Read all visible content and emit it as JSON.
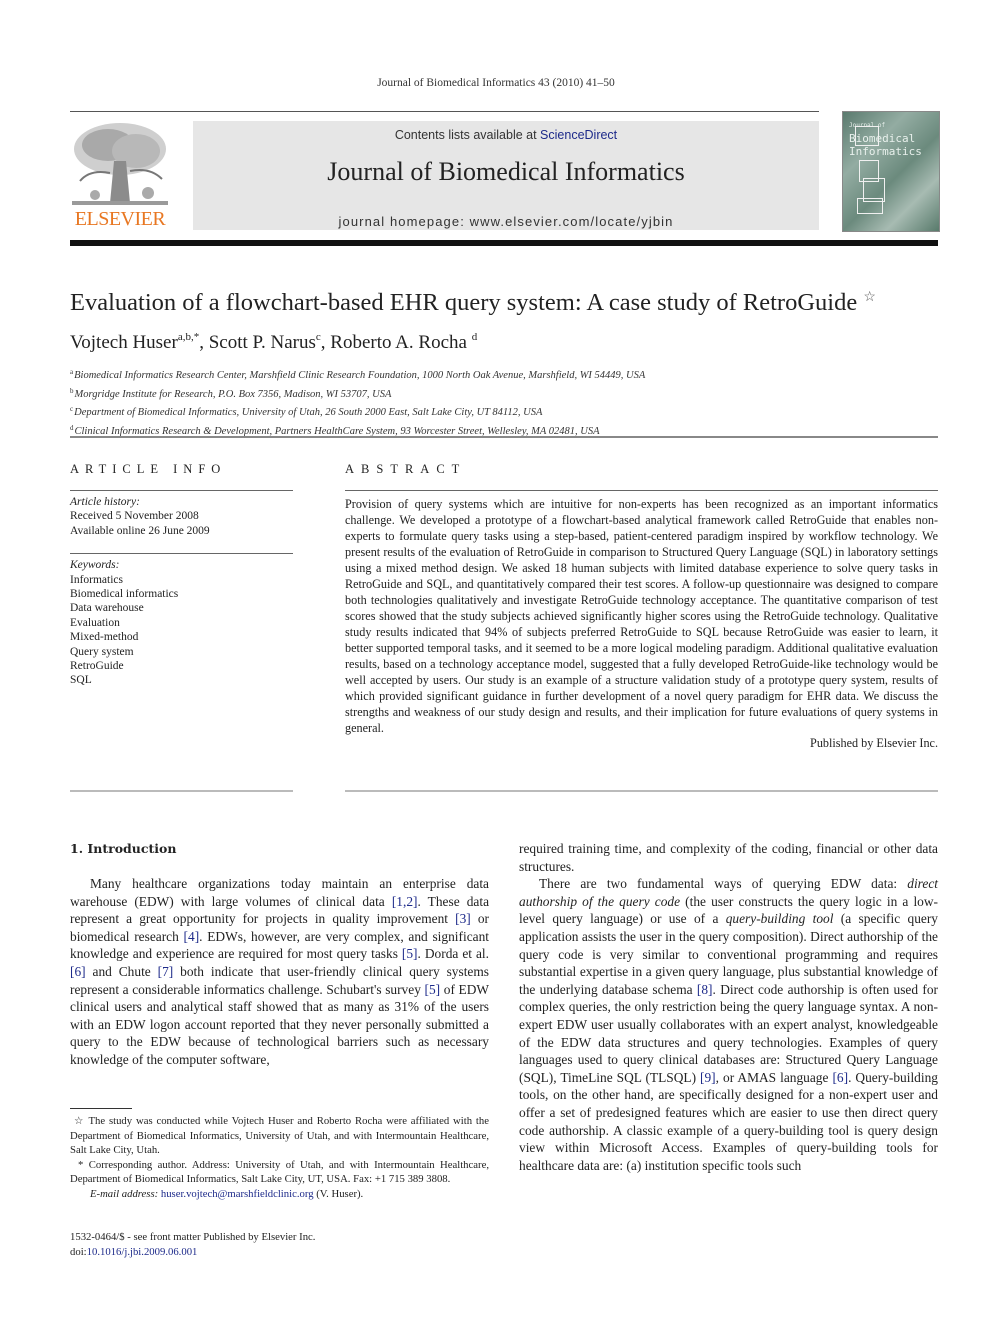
{
  "running_head": "Journal of Biomedical Informatics 43 (2010) 41–50",
  "banner": {
    "contents_prefix": "Contents lists available at ",
    "contents_link": "ScienceDirect",
    "journal_title": "Journal of Biomedical Informatics",
    "homepage": "journal homepage: www.elsevier.com/locate/yjbin"
  },
  "publisher_logo": {
    "wordmark": "ELSEVIER",
    "icon": "elsevier-tree-icon",
    "color": "#e87722"
  },
  "cover": {
    "line1": "Biomedical",
    "line2": "Informatics",
    "small": "Journal of"
  },
  "article": {
    "title": "Evaluation of a flowchart-based EHR query system: A case study of RetroGuide",
    "title_note": "☆",
    "authors": [
      {
        "name": "Vojtech Huser",
        "sup": "a,b,*",
        "sep": ", "
      },
      {
        "name": "Scott P. Narus",
        "sup": "c",
        "sep": ", "
      },
      {
        "name": "Roberto A. Rocha",
        "sup": "d",
        "sep": ""
      }
    ],
    "affiliations": [
      {
        "key": "a",
        "text": "Biomedical Informatics Research Center, Marshfield Clinic Research Foundation, 1000 North Oak Avenue, Marshfield, WI 54449, USA"
      },
      {
        "key": "b",
        "text": "Morgridge Institute for Research, P.O. Box 7356, Madison, WI 53707, USA"
      },
      {
        "key": "c",
        "text": "Department of Biomedical Informatics, University of Utah, 26 South 2000 East, Salt Lake City, UT 84112, USA"
      },
      {
        "key": "d",
        "text": "Clinical Informatics Research & Development, Partners HealthCare System, 93 Worcester Street, Wellesley, MA 02481, USA"
      }
    ]
  },
  "article_info": {
    "heading": "ARTICLE INFO",
    "history_label": "Article history:",
    "received": "Received 5 November 2008",
    "available": "Available online 26 June 2009",
    "keywords_label": "Keywords:",
    "keywords": [
      "Informatics",
      "Biomedical informatics",
      "Data warehouse",
      "Evaluation",
      "Mixed-method",
      "Query system",
      "RetroGuide",
      "SQL"
    ]
  },
  "abstract": {
    "heading": "ABSTRACT",
    "body": "Provision of query systems which are intuitive for non-experts has been recognized as an important informatics challenge. We developed a prototype of a flowchart-based analytical framework called RetroGuide that enables non-experts to formulate query tasks using a step-based, patient-centered par­adigm inspired by workflow technology. We present results of the evaluation of RetroGuide in compar­ison to Structured Query Language (SQL) in laboratory settings using a mixed method design. We asked 18 human subjects with limited database experience to solve query tasks in RetroGuide and SQL, and quantitatively compared their test scores. A follow-up questionnaire was designed to compare both tech­nologies qualitatively and investigate RetroGuide technology acceptance. The quantitative comparison of test scores showed that the study subjects achieved significantly higher scores using the RetroGuide tech­nology. Qualitative study results indicated that 94% of subjects preferred RetroGuide to SQL because Ret­roGuide was easier to learn, it better supported temporal tasks, and it seemed to be a more logical modeling paradigm. Additional qualitative evaluation results, based on a technology acceptance model, suggested that a fully developed RetroGuide-like technology would be well accepted by users. Our study is an example of a structure validation study of a prototype query system, results of which provided sig­nificant guidance in further development of a novel query paradigm for EHR data. We discuss the strengths and weakness of our study design and results, and their implication for future evaluations of query systems in general.",
    "published_by": "Published by Elsevier Inc."
  },
  "intro": {
    "heading": "1. Introduction",
    "left_segments": [
      {
        "t": "Many healthcare organizations today maintain an enterprise data warehouse (EDW) with large volumes of clinical data "
      },
      {
        "r": "[1,2]"
      },
      {
        "t": ". These data represent a great opportunity for projects in quality improvement "
      },
      {
        "r": "[3]"
      },
      {
        "t": " or biomedical research "
      },
      {
        "r": "[4]"
      },
      {
        "t": ". EDWs, however, are very complex, and significant knowledge and experience are re­quired for most query tasks "
      },
      {
        "r": "[5]"
      },
      {
        "t": ". Dorda et al. "
      },
      {
        "r": "[6]"
      },
      {
        "t": " and Chute "
      },
      {
        "r": "[7]"
      },
      {
        "t": " both indicate that user-friendly clinical query systems represent a con­siderable informatics challenge. Schubart's survey "
      },
      {
        "r": "[5]"
      },
      {
        "t": " of EDW clin­ical users and analytical staff showed that as many as 31% of the users with an EDW logon account reported that they never person­ally submitted a query to the EDW because of technological barri­ers such as necessary knowledge of the computer software,"
      }
    ],
    "right_p1": "required training time, and complexity of the coding, financial or other data structures.",
    "right_segments": [
      {
        "t": "There are two fundamental ways of querying EDW data: "
      },
      {
        "i": "direct authorship of the query code"
      },
      {
        "t": " (the user constructs the query logic in a low-level query language) or use of a "
      },
      {
        "i": "query-building tool"
      },
      {
        "t": " (a spe­cific query application assists the user in the query composition). Direct authorship of the query code is very similar to conventional programming and requires substantial expertise in a given query language, plus substantial knowledge of the underlying database schema "
      },
      {
        "r": "[8]"
      },
      {
        "t": ". Direct code authorship is often used for complex que­ries, the only restriction being the query language syntax. A non-expert EDW user usually collaborates with an expert analyst, knowledgeable of the EDW data structures and query technologies. Examples of query languages used to query clinical databases are: Structured Query Language (SQL), TimeLine SQL (TLSQL) "
      },
      {
        "r": "[9]"
      },
      {
        "t": ", or AMAS language "
      },
      {
        "r": "[6]"
      },
      {
        "t": ". Query-building tools, on the other hand, are specifically designed for a non-expert user and offer a set of pre­designed features which are easier to use then direct query code authorship. A classic example of a query-building tool is query de­sign view within Microsoft Access. Examples of query-building tools for healthcare data are: (a) institution specific tools such"
      }
    ]
  },
  "footnotes": {
    "star_mark": "☆",
    "star_text": " The study was conducted while Vojtech Huser and Roberto Rocha were affiliated with the Department of Biomedical Informatics, University of Utah, and with Intermountain Healthcare, Salt Lake City, Utah.",
    "corr_mark": "*",
    "corr_text": " Corresponding author. Address: University of Utah, and with Intermountain Healthcare, Department of Biomedical Informatics, Salt Lake City, UT, USA. Fax: +1 715 389 3808.",
    "email_label": "E-mail address:",
    "email": "huser.vojtech@marshfieldclinic.org",
    "email_suffix": " (V. Huser)."
  },
  "issn_line": "1532-0464/$ - see front matter Published by Elsevier Inc.",
  "doi_prefix": "doi:",
  "doi": "10.1016/j.jbi.2009.06.001",
  "colors": {
    "link": "#1d2a8a",
    "elsevier_orange": "#e87722",
    "banner_bg": "#e6e6e6"
  }
}
